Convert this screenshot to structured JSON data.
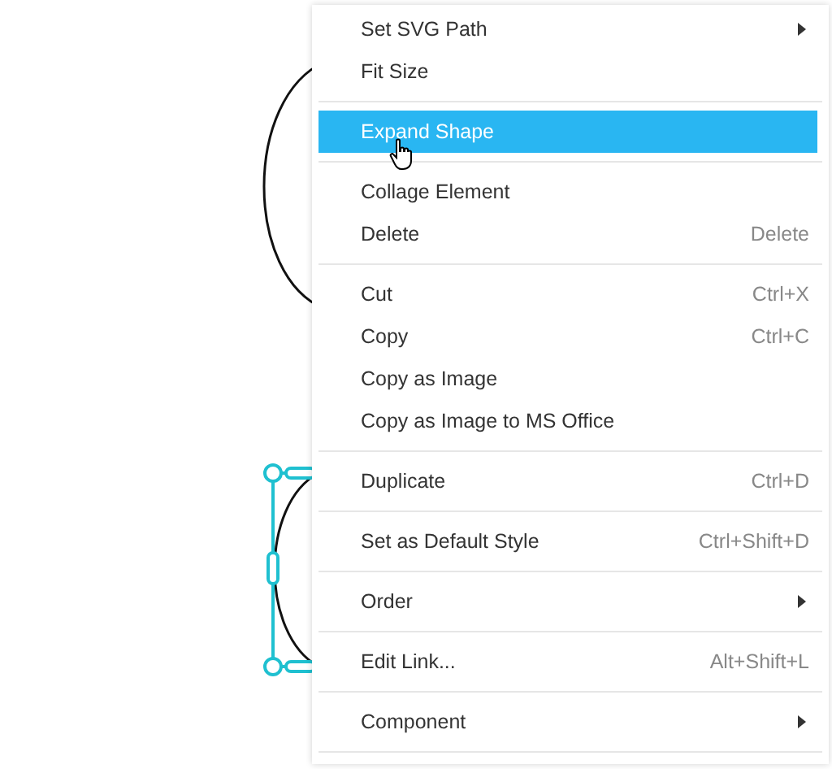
{
  "menu": {
    "groups": [
      [
        {
          "label": "Set SVG Path",
          "submenu": true,
          "selected": false
        },
        {
          "label": "Fit Size",
          "submenu": false,
          "selected": false
        }
      ],
      [
        {
          "label": "Expand Shape",
          "submenu": false,
          "selected": true
        }
      ],
      [
        {
          "label": "Collage Element",
          "submenu": false,
          "selected": false
        },
        {
          "label": "Delete",
          "shortcut": "Delete",
          "submenu": false,
          "selected": false
        }
      ],
      [
        {
          "label": "Cut",
          "shortcut": "Ctrl+X",
          "submenu": false,
          "selected": false
        },
        {
          "label": "Copy",
          "shortcut": "Ctrl+C",
          "submenu": false,
          "selected": false
        },
        {
          "label": "Copy as Image",
          "submenu": false,
          "selected": false
        },
        {
          "label": "Copy as Image to MS Office",
          "submenu": false,
          "selected": false
        }
      ],
      [
        {
          "label": "Duplicate",
          "shortcut": "Ctrl+D",
          "submenu": false,
          "selected": false
        }
      ],
      [
        {
          "label": "Set as Default Style",
          "shortcut": "Ctrl+Shift+D",
          "submenu": false,
          "selected": false
        }
      ],
      [
        {
          "label": "Order",
          "submenu": true,
          "selected": false
        }
      ],
      [
        {
          "label": "Edit Link...",
          "shortcut": "Alt+Shift+L",
          "submenu": false,
          "selected": false
        }
      ],
      [
        {
          "label": "Component",
          "submenu": true,
          "selected": false
        }
      ]
    ]
  }
}
